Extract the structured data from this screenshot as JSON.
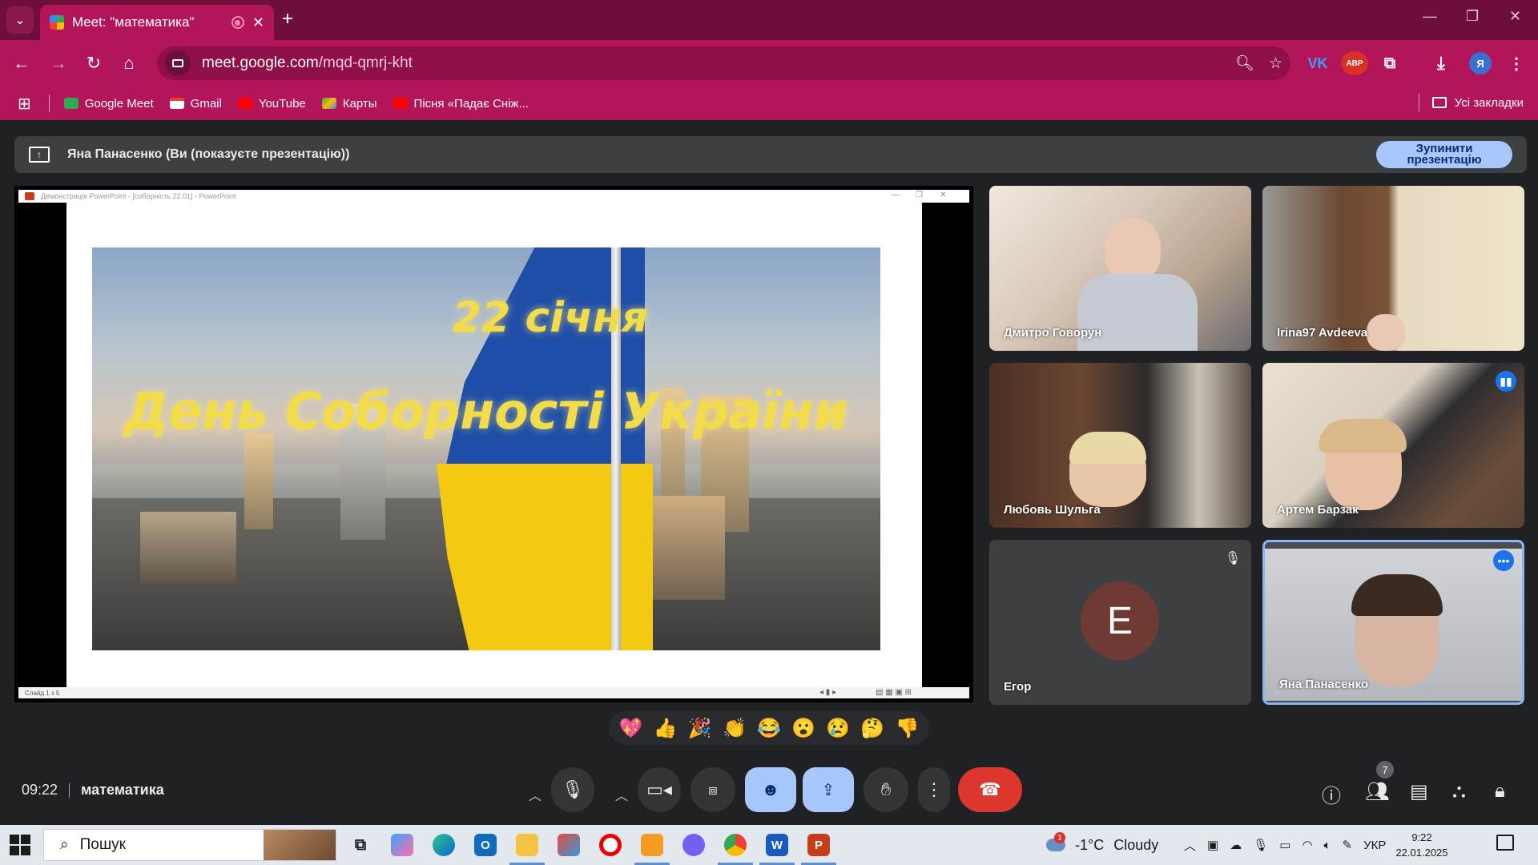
{
  "browser": {
    "tab_title": "Meet: \"математика\"",
    "url_host": "meet.google.com",
    "url_path": "/mqd-qmrj-kht",
    "extensions": [
      "VK",
      "ABP"
    ],
    "profile_initial": "Я",
    "bookmarks": [
      {
        "label": "Google Meet",
        "color": "#34a853"
      },
      {
        "label": "Gmail",
        "color": "#ea4335"
      },
      {
        "label": "YouTube",
        "color": "#ff0000"
      },
      {
        "label": "Карты",
        "color": "#4285f4"
      },
      {
        "label": "Пісня «Падає Сніж...",
        "color": "#ff0000"
      }
    ],
    "all_bookmarks_label": "Усі закладки"
  },
  "meet": {
    "presenting_text": "Яна Панасенко (Ви (показуєте презентацію))",
    "stop_button": "Зупинити презентацію",
    "ppt_window_title": "Демонстрація PowerPoint - [соборність 22.01] - PowerPoint",
    "ppt_status": "Слайд 1 з 5",
    "slide": {
      "line1": "22 січня",
      "line2": "День Соборності України"
    },
    "participants": [
      {
        "name": "Дмитро Говорун"
      },
      {
        "name": "Irina97 Avdeeva"
      },
      {
        "name": "Любовь Шульга"
      },
      {
        "name": "Артем Барзак"
      },
      {
        "name": "Егор",
        "initial": "Е"
      },
      {
        "name": "Яна Панасенко"
      }
    ],
    "reactions": [
      "💖",
      "👍",
      "🎉",
      "👏",
      "😂",
      "😮",
      "😢",
      "🤔",
      "👎"
    ],
    "time": "09:22",
    "meeting_name": "математика",
    "people_count": "7"
  },
  "taskbar": {
    "search_placeholder": "Пошук",
    "weather_temp": "-1°C",
    "weather_desc": "Cloudy",
    "weather_badge": "1",
    "language": "УКР",
    "time": "9:22",
    "date": "22.01.2025"
  },
  "colors": {
    "tab_strip": "#6d0e3b",
    "chrome": "#b3155a",
    "meet_bg": "#202124",
    "accent": "#a8c7fa",
    "end_call": "#dc362e"
  }
}
